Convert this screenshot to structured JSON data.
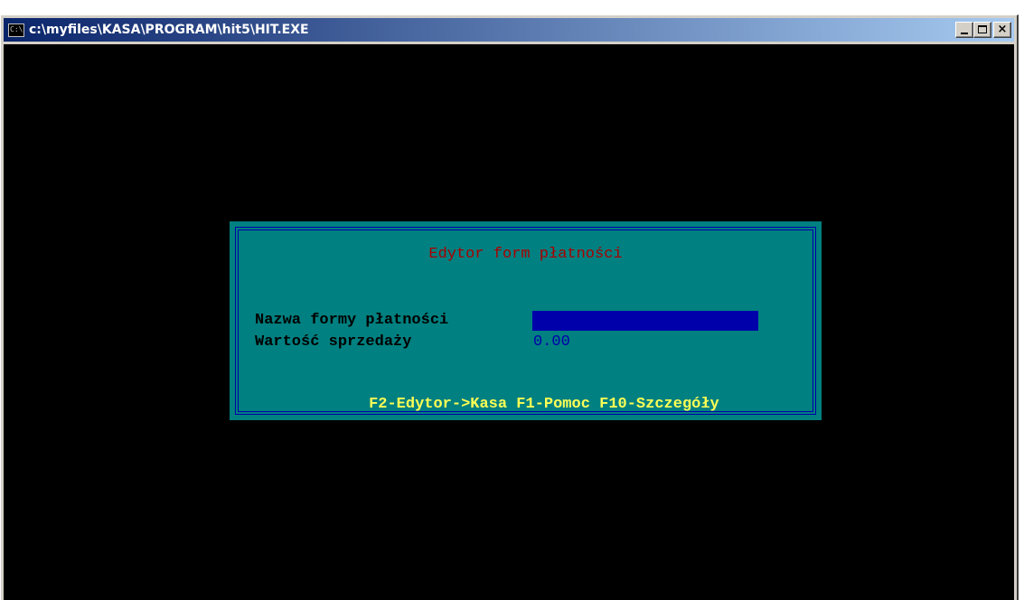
{
  "window": {
    "title": "c:\\myfiles\\KASA\\PROGRAM\\hit5\\HIT.EXE",
    "icon": "console-icon",
    "buttons": {
      "minimize": "minimize-icon",
      "maximize": "maximize-icon",
      "close": "×"
    }
  },
  "dialog": {
    "title": "Edytor form płatności",
    "fields": {
      "name_label": "Nazwa formy płatności",
      "name_value": "",
      "value_label": "Wartość sprzedaży",
      "value_value": "0.00"
    },
    "hints": [
      {
        "label": "F2-Edytor->Kasa"
      },
      {
        "label": "F1-Pomoc"
      },
      {
        "label": "F10-Szczegóły"
      }
    ]
  },
  "colors": {
    "dialog_bg": "#008080",
    "frame": "#0000aa",
    "title_text": "#aa0000",
    "hint_text": "#ffff55",
    "input_bg": "#0000aa",
    "value_text": "#0000aa"
  }
}
